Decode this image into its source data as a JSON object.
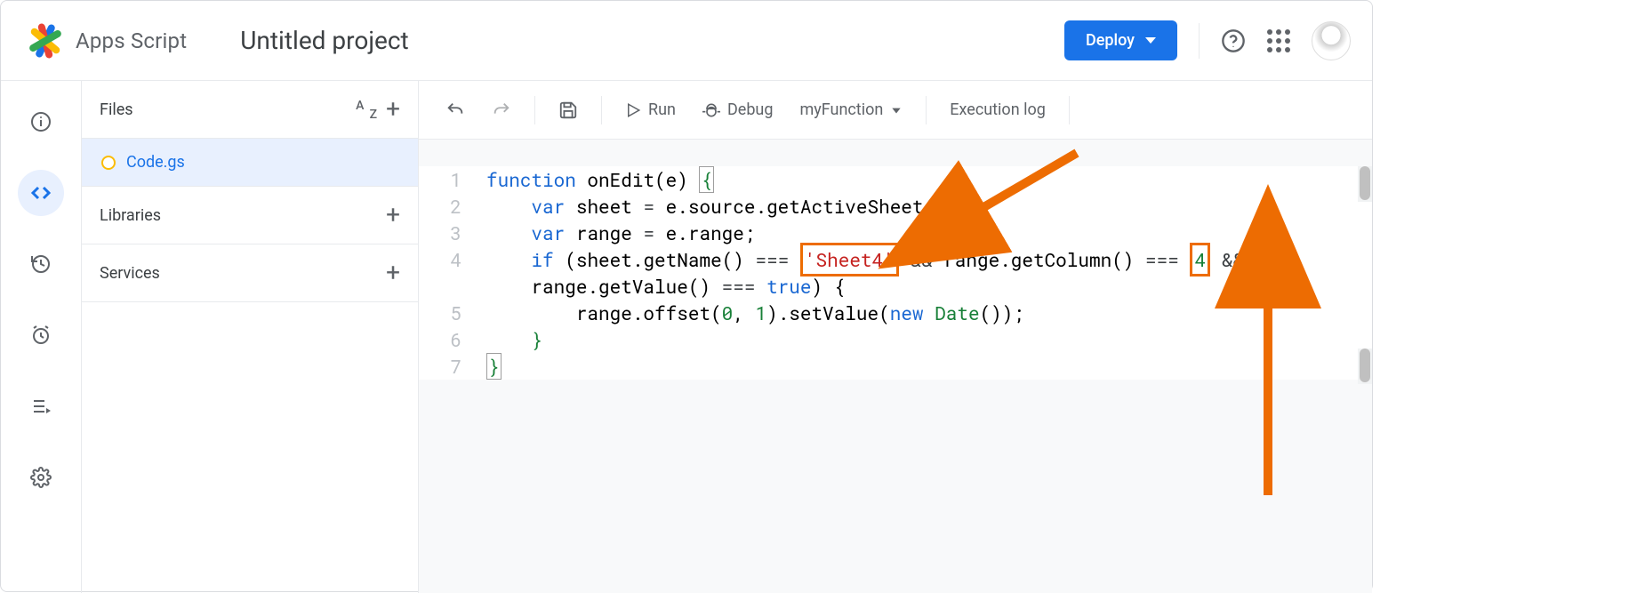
{
  "header": {
    "app_name": "Apps Script",
    "project_title": "Untitled project",
    "deploy_label": "Deploy"
  },
  "sidebar": {
    "files_label": "Files",
    "libraries_label": "Libraries",
    "services_label": "Services",
    "file_name": "Code.gs"
  },
  "toolbar": {
    "run_label": "Run",
    "debug_label": "Debug",
    "function_name": "myFunction",
    "exec_log_label": "Execution log"
  },
  "code": {
    "line_numbers": [
      "1",
      "2",
      "3",
      "4",
      "5",
      "6",
      "7"
    ],
    "highlight_sheet": "'Sheet4'",
    "highlight_col": "4",
    "tokens": {
      "l1_a": "function",
      "l1_b": " onEdit",
      "l1_c": "(e) ",
      "l1_d": "{",
      "l2_a": "    ",
      "l2_b": "var",
      "l2_c": " sheet ",
      "l2_d": "=",
      "l2_e": " e.source.getActiveSheet",
      "l2_f": "();",
      "l3_a": "    ",
      "l3_b": "var",
      "l3_c": " range ",
      "l3_d": "=",
      "l3_e": " e.range",
      "l3_f": ";",
      "l4_a": "    ",
      "l4_b": "if",
      "l4_c": " (sheet.getName() ",
      "l4_d": "===",
      "l4_e": " ",
      "l4_g": " ",
      "l4_h": "&&",
      "l4_i": " range.getColumn() ",
      "l4_j": "===",
      "l4_k": " ",
      "l4_m": " ",
      "l4_n": "&&",
      "l4b_a": "    range.getValue() ",
      "l4b_b": "===",
      "l4b_c": " ",
      "l4b_d": "true",
      "l4b_e": ") {",
      "l5_a": "        range.offset(",
      "l5_b": "0",
      "l5_c": ", ",
      "l5_d": "1",
      "l5_e": ").setValue(",
      "l5_f": "new",
      "l5_g": " ",
      "l5_h": "Date",
      "l5_i": "());",
      "l6_a": "    ",
      "l6_b": "}",
      "l7_a": "}"
    }
  }
}
